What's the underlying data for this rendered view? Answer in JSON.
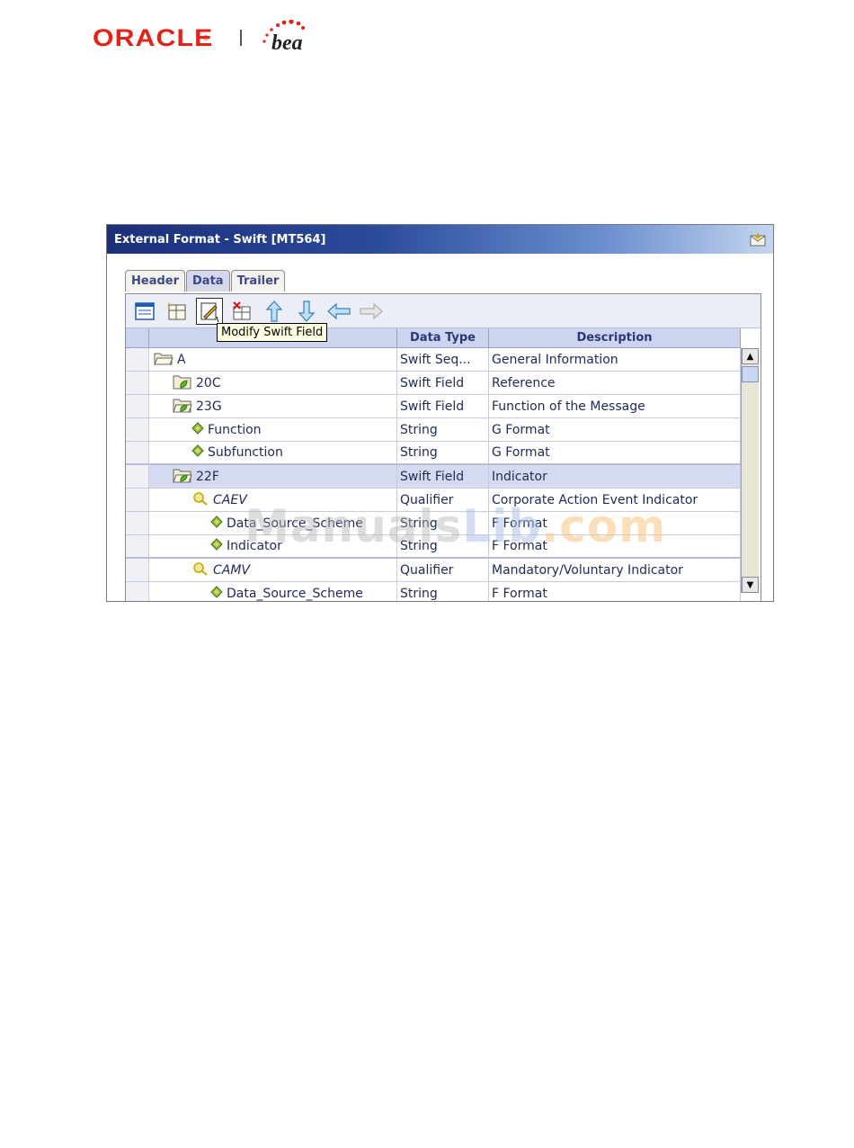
{
  "logo": {
    "oracle_text": "ORACLE",
    "bea_text": "bea"
  },
  "window": {
    "title": "External Format - Swift [MT564]"
  },
  "tabs": [
    {
      "label": "Header",
      "active": false
    },
    {
      "label": "Data",
      "active": true
    },
    {
      "label": "Trailer",
      "active": false
    }
  ],
  "toolbar": {
    "buttons": [
      "add-sequence-icon",
      "add-field-icon",
      "modify-field-icon",
      "delete-field-icon",
      "move-up-icon",
      "move-down-icon",
      "move-left-icon",
      "move-right-icon"
    ],
    "tooltip": "Modify Swift Field"
  },
  "grid": {
    "columns": [
      "",
      "Data Type",
      "Description"
    ],
    "rows": [
      {
        "name": "A",
        "type": "Swift Seq...",
        "desc": "General Information",
        "icon": "folder-open",
        "indent": 0
      },
      {
        "name": "20C",
        "type": "Swift Field",
        "desc": "Reference",
        "icon": "folder-leaf",
        "indent": 1
      },
      {
        "name": "23G",
        "type": "Swift Field",
        "desc": "Function of the Message",
        "icon": "folder-open-leaf",
        "indent": 1
      },
      {
        "name": "Function",
        "type": "String",
        "desc": "G Format",
        "icon": "diamond",
        "indent": 2
      },
      {
        "name": "Subfunction",
        "type": "String",
        "desc": "G Format",
        "icon": "diamond",
        "indent": 2
      },
      {
        "name": "22F",
        "type": "Swift Field",
        "desc": "Indicator",
        "icon": "folder-open-leaf",
        "indent": 1,
        "selected": true
      },
      {
        "name": "CAEV",
        "type": "Qualifier",
        "desc": "Corporate Action Event Indicator",
        "icon": "qualifier",
        "indent": 2
      },
      {
        "name": "Data_Source_Scheme",
        "type": "String",
        "desc": "F Format",
        "icon": "diamond",
        "indent": 3
      },
      {
        "name": "Indicator",
        "type": "String",
        "desc": "F Format",
        "icon": "diamond",
        "indent": 3
      },
      {
        "name": "CAMV",
        "type": "Qualifier",
        "desc": "Mandatory/Voluntary Indicator",
        "icon": "qualifier",
        "indent": 2
      },
      {
        "name": "Data_Source_Scheme",
        "type": "String",
        "desc": "F Format",
        "icon": "diamond",
        "indent": 3
      }
    ]
  },
  "watermark": {
    "part1": "Manuals",
    "part2": "Lib",
    "part3": ".com"
  },
  "colors": {
    "accent": "#2a3878",
    "selected_row": "#d6daf0",
    "header_bg": "#ccd4ef"
  }
}
